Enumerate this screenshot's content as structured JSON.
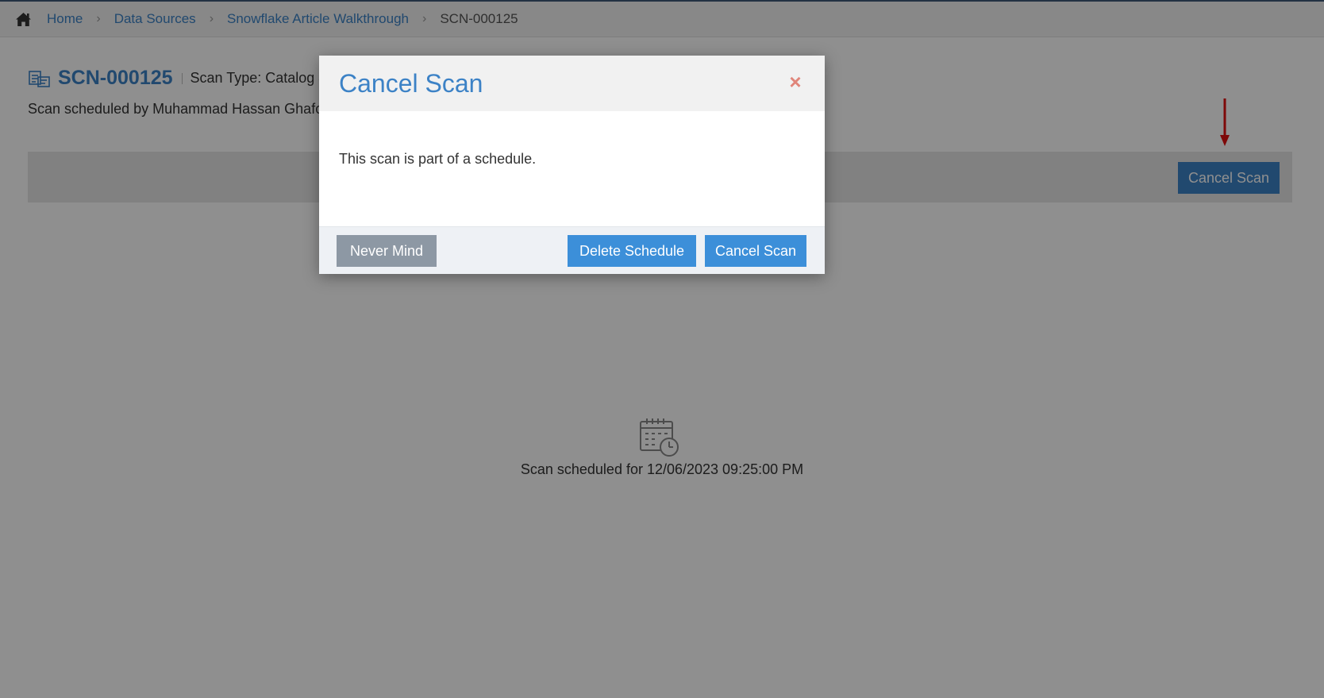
{
  "breadcrumb": {
    "home_icon": "home-icon",
    "items": [
      "Home",
      "Data Sources",
      "Snowflake Article Walkthrough"
    ],
    "current": "SCN-000125",
    "separator": "›"
  },
  "header": {
    "scan_icon": "scan-document-icon",
    "scan_id": "SCN-000125",
    "scan_type": "Scan Type: Catalog &",
    "subtitle": "Scan scheduled by Muhammad Hassan Ghafo"
  },
  "toolbar": {
    "cancel_scan_label": "Cancel Scan"
  },
  "empty_state": {
    "icon": "calendar-clock-icon",
    "text": "Scan scheduled for 12/06/2023 09:25:00 PM"
  },
  "modal": {
    "title": "Cancel Scan",
    "close_symbol": "×",
    "message": "This scan is part of a schedule.",
    "never_mind_label": "Never Mind",
    "delete_schedule_label": "Delete Schedule",
    "cancel_scan_label": "Cancel Scan"
  },
  "colors": {
    "accent": "#3c82c6",
    "button_primary": "#3c8fd9",
    "button_secondary": "#8d98a4",
    "close_icon": "#e0857a",
    "annotation_arrow": "#e01010"
  }
}
